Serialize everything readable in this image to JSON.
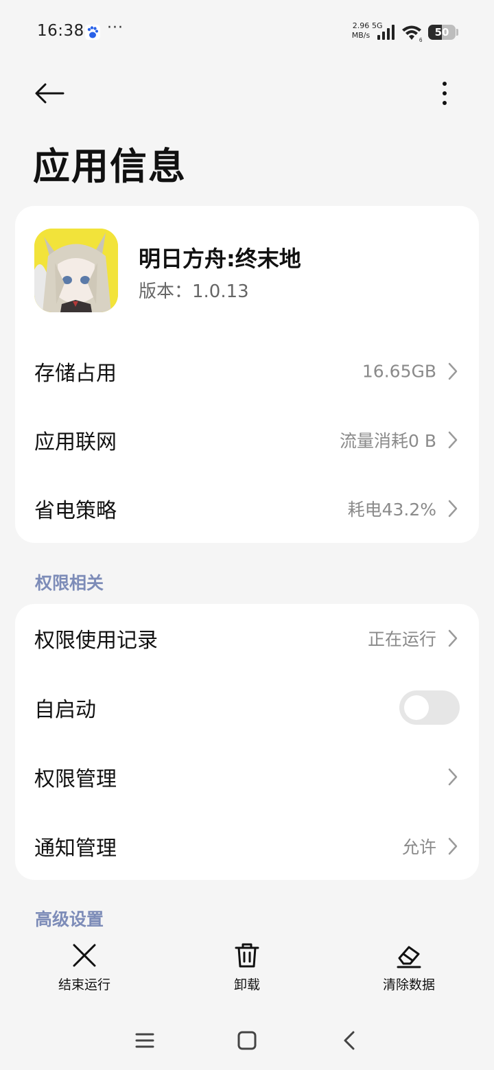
{
  "status_bar": {
    "time": "16:38",
    "dots": "···",
    "speed_value": "2.96",
    "speed_unit": "MB/s",
    "network": "5G",
    "battery": "50",
    "battery_level": 0.5
  },
  "header": {
    "title": "应用信息"
  },
  "app": {
    "name": "明日方舟:终末地",
    "version": "版本：1.0.13"
  },
  "usage_items": [
    {
      "label": "存储占用",
      "value": "16.65GB"
    },
    {
      "label": "应用联网",
      "value": "流量消耗0 B"
    },
    {
      "label": "省电策略",
      "value": "耗电43.2%"
    }
  ],
  "permissions": {
    "section_title": "权限相关",
    "items": [
      {
        "label": "权限使用记录",
        "value": "正在运行"
      },
      {
        "label": "自启动",
        "toggle": false
      },
      {
        "label": "权限管理",
        "value": ""
      },
      {
        "label": "通知管理",
        "value": "允许"
      }
    ]
  },
  "advanced": {
    "section_title": "高级设置"
  },
  "actions": {
    "stop": "结束运行",
    "uninstall": "卸载",
    "clear_data": "清除数据"
  },
  "colors": {
    "background": "#f5f5f5",
    "card": "#ffffff",
    "section_label": "#7d8cb8",
    "secondary_text": "#8a8a8a"
  }
}
